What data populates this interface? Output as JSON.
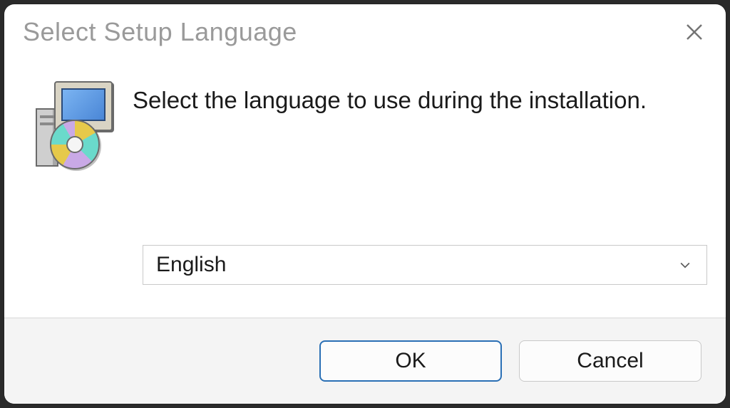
{
  "window": {
    "title": "Select Setup Language"
  },
  "content": {
    "instruction": "Select the language to use during the installation.",
    "language_select": {
      "value": "English"
    }
  },
  "buttons": {
    "ok": "OK",
    "cancel": "Cancel"
  }
}
